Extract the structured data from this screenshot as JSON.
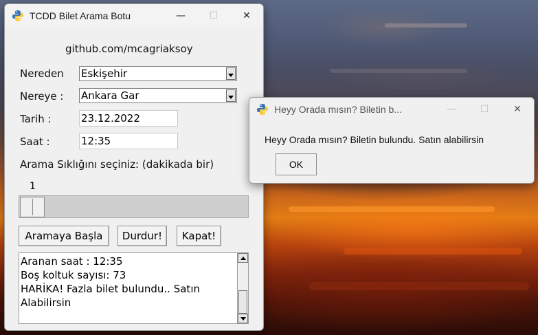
{
  "main_window": {
    "title": "TCDD Bilet Arama Botu",
    "credit": "github.com/mcagriaksoy",
    "from_label": "Nereden",
    "from_value": "Eskişehir",
    "to_label": "Nereye :",
    "to_value": "Ankara Gar",
    "date_label": "Tarih :",
    "date_value": "23.12.2022",
    "time_label": "Saat :",
    "time_value": "12:35",
    "frequency_label": "Arama Sıklığını seçiniz: (dakikada bir)",
    "slider_value": "1",
    "buttons": {
      "start": "Aramaya Başla",
      "stop": "Durdur!",
      "close": "Kapat!"
    },
    "log_lines": [
      "Aranan  saat : 12:35",
      "Boş koltuk sayısı: 73",
      "HARİKA! Fazla bilet bulundu.. Satın",
      "Alabilirsin"
    ]
  },
  "dialog": {
    "title": "Heyy Orada mısın? Biletin b...",
    "message": "Heyy Orada mısın? Biletin bulundu. Satın alabilirsin",
    "ok_label": "OK"
  },
  "titlebar_icons": {
    "minimize": "—",
    "maximize": "☐",
    "close": "✕"
  }
}
